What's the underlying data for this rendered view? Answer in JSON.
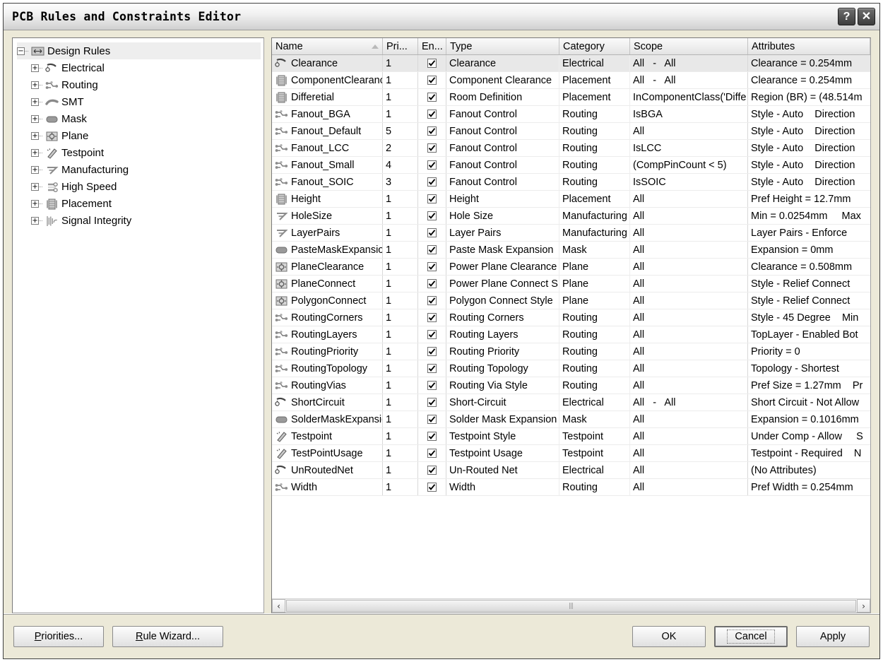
{
  "window": {
    "title": "PCB Rules and Constraints Editor",
    "help_button": "?",
    "close_button": "✕",
    "help_icon": "help-icon",
    "close_icon": "close-icon"
  },
  "tree": {
    "root": {
      "label": "Design Rules",
      "expander": "−",
      "icon": "design-rules-icon"
    },
    "items": [
      {
        "label": "Electrical",
        "expander": "+",
        "icon": "electrical-icon"
      },
      {
        "label": "Routing",
        "expander": "+",
        "icon": "routing-icon"
      },
      {
        "label": "SMT",
        "expander": "+",
        "icon": "smt-icon"
      },
      {
        "label": "Mask",
        "expander": "+",
        "icon": "mask-icon"
      },
      {
        "label": "Plane",
        "expander": "+",
        "icon": "plane-icon"
      },
      {
        "label": "Testpoint",
        "expander": "+",
        "icon": "testpoint-icon"
      },
      {
        "label": "Manufacturing",
        "expander": "+",
        "icon": "manufacturing-icon"
      },
      {
        "label": "High Speed",
        "expander": "+",
        "icon": "high-speed-icon"
      },
      {
        "label": "Placement",
        "expander": "+",
        "icon": "placement-icon"
      },
      {
        "label": "Signal Integrity",
        "expander": "+",
        "icon": "signal-integrity-icon"
      }
    ]
  },
  "grid": {
    "columns": [
      {
        "label": "Name",
        "key": "name",
        "sorted": true
      },
      {
        "label": "Pri...",
        "key": "priority"
      },
      {
        "label": "En...",
        "key": "enabled"
      },
      {
        "label": "Type",
        "key": "type"
      },
      {
        "label": "Category",
        "key": "category"
      },
      {
        "label": "Scope",
        "key": "scope"
      },
      {
        "label": "Attributes",
        "key": "attributes"
      }
    ],
    "rows": [
      {
        "icon": "electrical-icon",
        "name": "Clearance",
        "priority": "1",
        "enabled": true,
        "type": "Clearance",
        "category": "Electrical",
        "scope": "All   -   All",
        "attributes": "Clearance = 0.254mm",
        "selected": true
      },
      {
        "icon": "placement-icon",
        "name": "ComponentClearanc",
        "priority": "1",
        "enabled": true,
        "type": "Component Clearance",
        "category": "Placement",
        "scope": "All   -   All",
        "attributes": "Clearance = 0.254mm"
      },
      {
        "icon": "placement-icon",
        "name": "Differetial",
        "priority": "1",
        "enabled": true,
        "type": "Room Definition",
        "category": "Placement",
        "scope": "InComponentClass('Diffe",
        "attributes": "Region (BR) = (48.514m"
      },
      {
        "icon": "routing-icon",
        "name": "Fanout_BGA",
        "priority": "1",
        "enabled": true,
        "type": "Fanout Control",
        "category": "Routing",
        "scope": "IsBGA",
        "attributes": "Style - Auto    Direction"
      },
      {
        "icon": "routing-icon",
        "name": "Fanout_Default",
        "priority": "5",
        "enabled": true,
        "type": "Fanout Control",
        "category": "Routing",
        "scope": "All",
        "attributes": "Style - Auto    Direction"
      },
      {
        "icon": "routing-icon",
        "name": "Fanout_LCC",
        "priority": "2",
        "enabled": true,
        "type": "Fanout Control",
        "category": "Routing",
        "scope": "IsLCC",
        "attributes": "Style - Auto    Direction"
      },
      {
        "icon": "routing-icon",
        "name": "Fanout_Small",
        "priority": "4",
        "enabled": true,
        "type": "Fanout Control",
        "category": "Routing",
        "scope": "(CompPinCount < 5)",
        "attributes": "Style - Auto    Direction"
      },
      {
        "icon": "routing-icon",
        "name": "Fanout_SOIC",
        "priority": "3",
        "enabled": true,
        "type": "Fanout Control",
        "category": "Routing",
        "scope": "IsSOIC",
        "attributes": "Style - Auto    Direction"
      },
      {
        "icon": "placement-icon",
        "name": "Height",
        "priority": "1",
        "enabled": true,
        "type": "Height",
        "category": "Placement",
        "scope": "All",
        "attributes": "Pref Height = 12.7mm"
      },
      {
        "icon": "manufacturing-icon",
        "name": "HoleSize",
        "priority": "1",
        "enabled": true,
        "type": "Hole Size",
        "category": "Manufacturing",
        "scope": "All",
        "attributes": "Min = 0.0254mm     Max"
      },
      {
        "icon": "manufacturing-icon",
        "name": "LayerPairs",
        "priority": "1",
        "enabled": true,
        "type": "Layer Pairs",
        "category": "Manufacturing",
        "scope": "All",
        "attributes": "Layer Pairs - Enforce"
      },
      {
        "icon": "mask-icon",
        "name": "PasteMaskExpansio",
        "priority": "1",
        "enabled": true,
        "type": "Paste Mask Expansion",
        "category": "Mask",
        "scope": "All",
        "attributes": "Expansion = 0mm"
      },
      {
        "icon": "plane-icon",
        "name": "PlaneClearance",
        "priority": "1",
        "enabled": true,
        "type": "Power Plane Clearance",
        "category": "Plane",
        "scope": "All",
        "attributes": "Clearance = 0.508mm"
      },
      {
        "icon": "plane-icon",
        "name": "PlaneConnect",
        "priority": "1",
        "enabled": true,
        "type": "Power Plane Connect S",
        "category": "Plane",
        "scope": "All",
        "attributes": "Style - Relief Connect"
      },
      {
        "icon": "plane-icon",
        "name": "PolygonConnect",
        "priority": "1",
        "enabled": true,
        "type": "Polygon Connect Style",
        "category": "Plane",
        "scope": "All",
        "attributes": "Style - Relief Connect"
      },
      {
        "icon": "routing-icon",
        "name": "RoutingCorners",
        "priority": "1",
        "enabled": true,
        "type": "Routing Corners",
        "category": "Routing",
        "scope": "All",
        "attributes": "Style - 45 Degree    Min"
      },
      {
        "icon": "routing-icon",
        "name": "RoutingLayers",
        "priority": "1",
        "enabled": true,
        "type": "Routing Layers",
        "category": "Routing",
        "scope": "All",
        "attributes": "TopLayer - Enabled Bot"
      },
      {
        "icon": "routing-icon",
        "name": "RoutingPriority",
        "priority": "1",
        "enabled": true,
        "type": "Routing Priority",
        "category": "Routing",
        "scope": "All",
        "attributes": "Priority = 0"
      },
      {
        "icon": "routing-icon",
        "name": "RoutingTopology",
        "priority": "1",
        "enabled": true,
        "type": "Routing Topology",
        "category": "Routing",
        "scope": "All",
        "attributes": "Topology - Shortest"
      },
      {
        "icon": "routing-icon",
        "name": "RoutingVias",
        "priority": "1",
        "enabled": true,
        "type": "Routing Via Style",
        "category": "Routing",
        "scope": "All",
        "attributes": "Pref Size = 1.27mm    Pr"
      },
      {
        "icon": "electrical-icon",
        "name": "ShortCircuit",
        "priority": "1",
        "enabled": true,
        "type": "Short-Circuit",
        "category": "Electrical",
        "scope": "All   -   All",
        "attributes": "Short Circuit - Not Allow"
      },
      {
        "icon": "mask-icon",
        "name": "SolderMaskExpansio",
        "priority": "1",
        "enabled": true,
        "type": "Solder Mask Expansion",
        "category": "Mask",
        "scope": "All",
        "attributes": "Expansion = 0.1016mm"
      },
      {
        "icon": "testpoint-icon",
        "name": "Testpoint",
        "priority": "1",
        "enabled": true,
        "type": "Testpoint Style",
        "category": "Testpoint",
        "scope": "All",
        "attributes": "Under Comp - Allow     S"
      },
      {
        "icon": "testpoint-icon",
        "name": "TestPointUsage",
        "priority": "1",
        "enabled": true,
        "type": "Testpoint Usage",
        "category": "Testpoint",
        "scope": "All",
        "attributes": "Testpoint - Required    N"
      },
      {
        "icon": "electrical-icon",
        "name": "UnRoutedNet",
        "priority": "1",
        "enabled": true,
        "type": "Un-Routed Net",
        "category": "Electrical",
        "scope": "All",
        "attributes": "(No Attributes)"
      },
      {
        "icon": "routing-icon",
        "name": "Width",
        "priority": "1",
        "enabled": true,
        "type": "Width",
        "category": "Routing",
        "scope": "All",
        "attributes": "Pref Width = 0.254mm"
      }
    ]
  },
  "scrollbar": {
    "left_arrow": "‹",
    "right_arrow": "›"
  },
  "footer": {
    "priorities": {
      "mnemonic": "P",
      "rest": "riorities..."
    },
    "rule_wizard": {
      "mnemonic": "R",
      "rest": "ule Wizard..."
    },
    "ok": "OK",
    "cancel": "Cancel",
    "apply": "Apply"
  }
}
